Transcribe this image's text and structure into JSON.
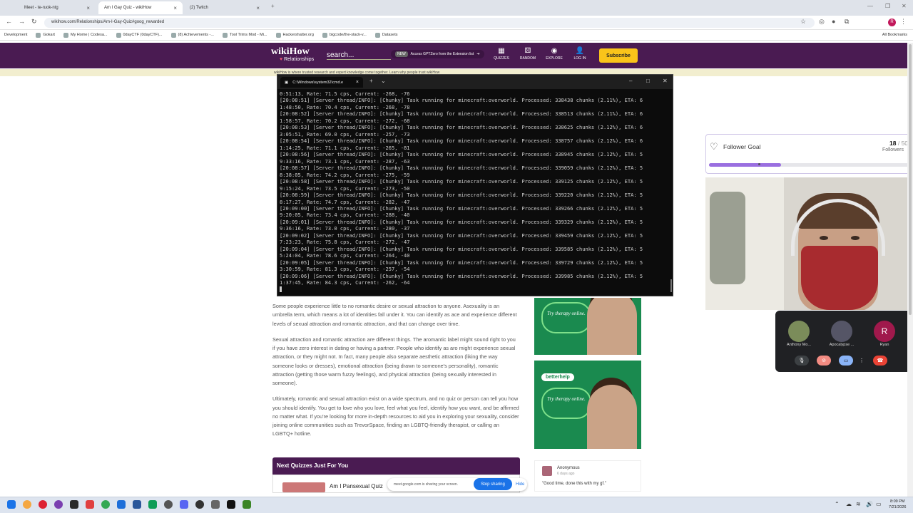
{
  "browser": {
    "tabs": [
      {
        "title": "Meet - te-ruok-ntg",
        "active": false
      },
      {
        "title": "Am I Gay Quiz - wikiHow",
        "active": true
      },
      {
        "title": "(2) Twitch",
        "active": false
      }
    ],
    "url": "wikihow.com/Relationships/Am-I-Gay-Quiz#goog_rewarded",
    "bookmarks": [
      "Development",
      "Gokart",
      "My Home | Codesa...",
      "0dayCTF (0dayCTF)...",
      "(8) Achievements -...",
      "Tool Trims Mod - Mi...",
      "Hackershatter.org",
      "bigcode/the-stack-v...",
      "Datasets"
    ],
    "all_bookmarks": "All Bookmarks",
    "profile_initial": "R"
  },
  "wikihow": {
    "logo": "wikiHow",
    "section": "Relationships",
    "search_placeholder": "search...",
    "promo_new": "NEW",
    "promo_text": "Access GPTZero from the Extension list",
    "nav": [
      "QUIZZES",
      "RANDOM",
      "EXPLORE",
      "LOG IN"
    ],
    "subscribe": "Subscribe",
    "banner": "wikiHow is where trusted research and expert knowledge come together. Learn why people trust wikiHow",
    "paragraphs": [
      "Some people experience little to no romantic desire or sexual attraction to anyone. Asexuality is an umbrella term, which means a lot of identities fall under it. You can identify as ace and experience different levels of sexual attraction and romantic attraction, and that can change over time.",
      "Sexual attraction and romantic attraction are different things. The aromantic label might sound right to you if you have zero interest in dating or having a partner. People who identify as aro might experience sexual attraction, or they might not. In fact, many people also separate aesthetic attraction (liking the way someone looks or dresses), emotional attraction (being drawn to someone's personality), romantic attraction (getting those warm fuzzy feelings), and physical attraction (being sexually interested in someone).",
      "Ultimately, romantic and sexual attraction exist on a wide spectrum, and no quiz or person can tell you how you should identify. You get to love who you love, feel what you feel, identify how you want, and be affirmed no matter what. If you're looking for more in-depth resources to aid you in exploring your sexuality, consider joining online communities such as TrevorSpace, finding an LGBTQ-friendly therapist, or calling an LGBTQ+ hotline."
    ],
    "next_quizzes_title": "Next Quizzes Just For You",
    "next_quiz_item": "Am I Pansexual Quiz",
    "ad_brand": "betterhelp",
    "ad_tagline": "Try therapy online.",
    "comment": {
      "name": "Anonymous",
      "time": "6 days ago",
      "text": "\"Good time, done this with my gf.\""
    }
  },
  "cmd": {
    "title": "C:\\Windows\\system32\\cmd.e",
    "lines": [
      "0:51:13, Rate: 71.5 cps, Current: -268, -76",
      "[20:08:51] [Server thread/INFO]: [Chunky] Task running for minecraft:overworld. Processed: 338438 chunks (2.11%), ETA: 6",
      "1:48:50, Rate: 70.4 cps, Current: -268, -78",
      "[20:08:52] [Server thread/INFO]: [Chunky] Task running for minecraft:overworld. Processed: 338513 chunks (2.11%), ETA: 6",
      "1:58:57, Rate: 70.2 cps, Current: -272, -68",
      "[20:08:53] [Server thread/INFO]: [Chunky] Task running for minecraft:overworld. Processed: 338625 chunks (2.12%), ETA: 6",
      "3:05:51, Rate: 69.0 cps, Current: -257, -73",
      "[20:08:54] [Server thread/INFO]: [Chunky] Task running for minecraft:overworld. Processed: 338757 chunks (2.12%), ETA: 6",
      "1:14:25, Rate: 71.1 cps, Current: -265, -81",
      "[20:08:56] [Server thread/INFO]: [Chunky] Task running for minecraft:overworld. Processed: 338945 chunks (2.12%), ETA: 5",
      "9:33:16, Rate: 73.1 cps, Current: -287, -63",
      "[20:08:57] [Server thread/INFO]: [Chunky] Task running for minecraft:overworld. Processed: 339059 chunks (2.12%), ETA: 5",
      "8:38:05, Rate: 74.2 cps, Current: -275, -59",
      "[20:08:58] [Server thread/INFO]: [Chunky] Task running for minecraft:overworld. Processed: 339125 chunks (2.12%), ETA: 5",
      "9:15:24, Rate: 73.5 cps, Current: -273, -50",
      "[20:08:59] [Server thread/INFO]: [Chunky] Task running for minecraft:overworld. Processed: 339220 chunks (2.12%), ETA: 5",
      "8:17:27, Rate: 74.7 cps, Current: -282, -47",
      "[20:09:00] [Server thread/INFO]: [Chunky] Task running for minecraft:overworld. Processed: 339266 chunks (2.12%), ETA: 5",
      "9:20:05, Rate: 73.4 cps, Current: -288, -40",
      "[20:09:01] [Server thread/INFO]: [Chunky] Task running for minecraft:overworld. Processed: 339329 chunks (2.12%), ETA: 5",
      "9:36:16, Rate: 73.0 cps, Current: -280, -37",
      "[20:09:02] [Server thread/INFO]: [Chunky] Task running for minecraft:overworld. Processed: 339459 chunks (2.12%), ETA: 5",
      "7:23:23, Rate: 75.8 cps, Current: -272, -47",
      "[20:09:04] [Server thread/INFO]: [Chunky] Task running for minecraft:overworld. Processed: 339585 chunks (2.12%), ETA: 5",
      "5:24:04, Rate: 78.6 cps, Current: -264, -40",
      "[20:09:05] [Server thread/INFO]: [Chunky] Task running for minecraft:overworld. Processed: 339729 chunks (2.12%), ETA: 5",
      "3:30:59, Rate: 81.3 cps, Current: -257, -54",
      "[20:09:06] [Server thread/INFO]: [Chunky] Task running for minecraft:overworld. Processed: 339985 chunks (2.12%), ETA: 5",
      "1:37:45, Rate: 84.3 cps, Current: -262, -64"
    ]
  },
  "follower_goal": {
    "label": "Follower Goal",
    "current": "18",
    "separator": "/ 50",
    "unit": "Followers",
    "progress_fraction": 0.36,
    "accent": "#9a6fe0"
  },
  "meet": {
    "participants": [
      "Anthony Mo...",
      "Apocalypse ...",
      "Ryan"
    ],
    "ryan_initial": "R",
    "share_text": "meet.google.com is sharing your screen.",
    "stop_sharing": "Stop sharing",
    "hide": "Hide"
  },
  "taskbar": {
    "time": "8:09 PM",
    "date": "7/21/2026"
  }
}
